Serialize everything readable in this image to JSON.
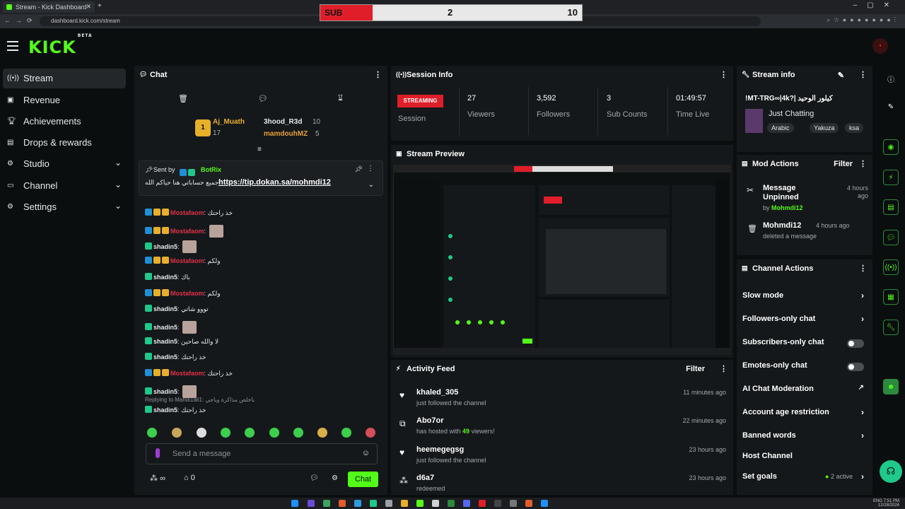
{
  "browser": {
    "tab_title": "Stream - Kick Dashboard",
    "url": "dashboard.kick.com/stream"
  },
  "overlay": {
    "sub_label": "SUB",
    "sub_count": "2",
    "sub_goal": "10"
  },
  "header": {
    "logo": "KICK",
    "logo_badge": "BETA"
  },
  "sidebar": {
    "items": [
      {
        "label": "Stream",
        "icon": "broadcast-icon"
      },
      {
        "label": "Revenue",
        "icon": "wallet-icon"
      },
      {
        "label": "Achievements",
        "icon": "trophy-icon"
      },
      {
        "label": "Drops & rewards",
        "icon": "gift-icon"
      },
      {
        "label": "Studio",
        "icon": "gear-icon"
      },
      {
        "label": "Channel",
        "icon": "channel-icon"
      },
      {
        "label": "Settings",
        "icon": "settings-icon"
      }
    ]
  },
  "chat": {
    "title": "Chat",
    "gifters": [
      {
        "name": "Aj_Muath",
        "count": "17",
        "rank": "1"
      },
      {
        "name": "3hood_R3d",
        "count": "10"
      },
      {
        "name": "mamdouhMZ",
        "count": "5"
      }
    ],
    "pinned": {
      "sent_by_label": "Sent by",
      "sender": "BotRix",
      "text_prefix": "جميع حساباتي هنا حياكم الله:",
      "link": "https://tip.dokan.sa/mohmdi12"
    },
    "messages": [
      {
        "user": "Mostafaom",
        "text": "خذ راحتك",
        "color": "#e0314b"
      },
      {
        "user": "Mostafaom",
        "text": "",
        "color": "#e0314b",
        "emote": true
      },
      {
        "user": "shadin5",
        "text": "",
        "color": "#e6e8ea",
        "emote": true
      },
      {
        "user": "Mostafaom",
        "text": "ولكم",
        "color": "#e0314b"
      },
      {
        "user": "shadin5",
        "text": "باك",
        "color": "#e6e8ea"
      },
      {
        "user": "Mostafaom",
        "text": "ولكم",
        "color": "#e0314b"
      },
      {
        "user": "shadin5",
        "text": "تووو شاتي",
        "color": "#e6e8ea"
      },
      {
        "user": "shadin5",
        "text": "",
        "color": "#e6e8ea",
        "emote": true
      },
      {
        "user": "shadin5",
        "text": "لا والله صاحين",
        "color": "#e6e8ea"
      },
      {
        "user": "shadin5",
        "text": "خذ راحتك",
        "color": "#e6e8ea"
      },
      {
        "user": "Mostafaom",
        "text": "خذ راحتك",
        "color": "#e0314b"
      },
      {
        "user": "shadin5",
        "text": "",
        "color": "#e6e8ea",
        "emote": true
      }
    ],
    "reply_note": "Replying to Mahdi1ali1: باخلص مذاكرة وباجي",
    "last_message": {
      "user": "shadin5",
      "text": "خذ راحتك"
    },
    "input_placeholder": "Send a message",
    "viewer_mode": "∞",
    "store_count": "0",
    "send_button": "Chat"
  },
  "session": {
    "title": "Session Info",
    "status": "STREAMING",
    "status_label": "Session",
    "stats": [
      {
        "value": "27",
        "label": "Viewers"
      },
      {
        "value": "3,592",
        "label": "Followers"
      },
      {
        "value": "3",
        "label": "Sub Counts"
      },
      {
        "value": "01:49:57",
        "label": "Time Live"
      }
    ]
  },
  "preview": {
    "title": "Stream Preview"
  },
  "activity": {
    "title": "Activity Feed",
    "filter": "Filter",
    "items": [
      {
        "user": "khaled_305",
        "action": "just followed the channel",
        "time": "11 minutes ago",
        "icon": "heart-icon"
      },
      {
        "user": "Abo7or",
        "action_prefix": "has hosted with ",
        "highlight": "49",
        "action_suffix": " viewers!",
        "time": "22 minutes ago",
        "icon": "host-icon"
      },
      {
        "user": "heemegegsg",
        "action": "just followed the channel",
        "time": "23 hours ago",
        "icon": "heart-icon"
      },
      {
        "user": "d6a7",
        "action": "redeemed",
        "time": "23 hours ago",
        "icon": "redeem-icon"
      }
    ]
  },
  "stream_info": {
    "title": "Stream info",
    "stream_title": "!MT-TRG∞|4k?| كيلور الوحيد",
    "category": "Just Chatting",
    "tags": [
      "Arabic",
      "Yakuza",
      "ksa"
    ]
  },
  "mod_actions": {
    "title": "Mod Actions",
    "filter": "Filter",
    "items": [
      {
        "action": "Message Unpinned",
        "by_label": "by",
        "by": "Mohmdi12",
        "time": "4 hours ago"
      },
      {
        "action": "Mohmdi12",
        "detail": "deleted a message",
        "time": "4 hours ago"
      }
    ]
  },
  "channel_actions": {
    "title": "Channel Actions",
    "items": [
      {
        "label": "Slow mode",
        "control": "chevron"
      },
      {
        "label": "Followers-only chat",
        "control": "chevron"
      },
      {
        "label": "Subscribers-only chat",
        "control": "toggle"
      },
      {
        "label": "Emotes-only chat",
        "control": "toggle"
      },
      {
        "label": "AI Chat Moderation",
        "control": "external"
      },
      {
        "label": "Account age restriction",
        "control": "chevron"
      },
      {
        "label": "Banned words",
        "control": "chevron"
      },
      {
        "label": "Host Channel",
        "control": "none"
      },
      {
        "label": "Set goals",
        "control": "chevron",
        "status": "2 active"
      }
    ]
  },
  "colors": {
    "accent": "#53fc18",
    "live": "#e01e2a",
    "panel": "#15181a",
    "bg": "#0b0e0f"
  },
  "taskbar": {
    "lang": "ENG",
    "time": "7:51 PM",
    "date": "12/28/2024"
  }
}
